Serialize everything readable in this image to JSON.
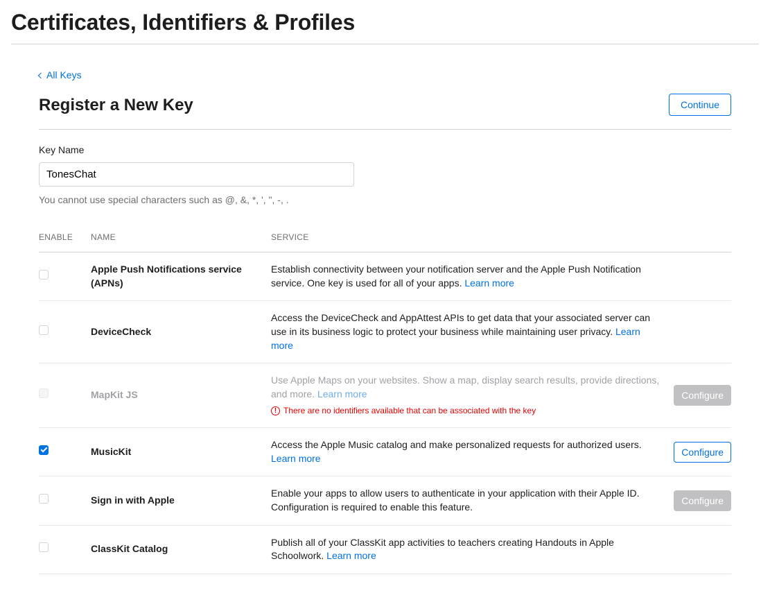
{
  "header": {
    "title": "Certificates, Identifiers & Profiles"
  },
  "back_link": "All Keys",
  "section_title": "Register a New Key",
  "continue_label": "Continue",
  "form": {
    "key_name_label": "Key Name",
    "key_name_value": "TonesChat",
    "helper": "You cannot use special characters such as @, &, *, ', \", -, ."
  },
  "table": {
    "headers": {
      "enable": "ENABLE",
      "name": "NAME",
      "service": "SERVICE"
    },
    "learn_more": "Learn more",
    "configure_label": "Configure",
    "warning_text": "There are no identifiers available that can be associated with the key"
  },
  "services": [
    {
      "name": "Apple Push Notifications service (APNs)",
      "desc": "Establish connectivity between your notification server and the Apple Push Notification service. One key is used for all of your apps."
    },
    {
      "name": "DeviceCheck",
      "desc": "Access the DeviceCheck and AppAttest APIs to get data that your associated server can use in its business logic to protect your business while maintaining user privacy."
    },
    {
      "name": "MapKit JS",
      "desc": "Use Apple Maps on your websites. Show a map, display search results, provide directions, and more."
    },
    {
      "name": "MusicKit",
      "desc": "Access the Apple Music catalog and make personalized requests for authorized users."
    },
    {
      "name": "Sign in with Apple",
      "desc": "Enable your apps to allow users to authenticate in your application with their Apple ID. Configuration is required to enable this feature."
    },
    {
      "name": "ClassKit Catalog",
      "desc": "Publish all of your ClassKit app activities to teachers creating Handouts in Apple Schoolwork."
    }
  ]
}
